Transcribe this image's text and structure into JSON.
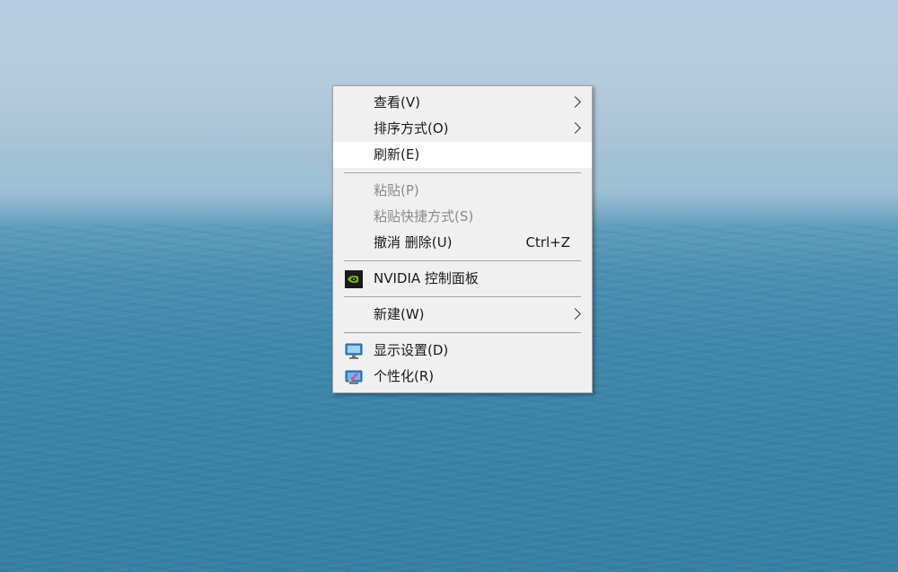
{
  "context_menu": {
    "items": [
      {
        "label": "查看(V)",
        "has_submenu": true
      },
      {
        "label": "排序方式(O)",
        "has_submenu": true
      },
      {
        "label": "刷新(E)",
        "highlighted": true
      },
      {
        "label": "粘贴(P)",
        "disabled": true
      },
      {
        "label": "粘贴快捷方式(S)",
        "disabled": true
      },
      {
        "label": "撤消 删除(U)",
        "shortcut": "Ctrl+Z"
      },
      {
        "label": "NVIDIA 控制面板",
        "icon": "nvidia-icon"
      },
      {
        "label": "新建(W)",
        "has_submenu": true
      },
      {
        "label": "显示设置(D)",
        "icon": "display-icon"
      },
      {
        "label": "个性化(R)",
        "icon": "personalize-icon"
      }
    ]
  },
  "colors": {
    "menu_bg": "#f0f0f0",
    "menu_border": "#a0a0a0",
    "highlight_bg": "#ffffff",
    "disabled_text": "#8a8a8a",
    "nvidia_green": "#76b900"
  }
}
